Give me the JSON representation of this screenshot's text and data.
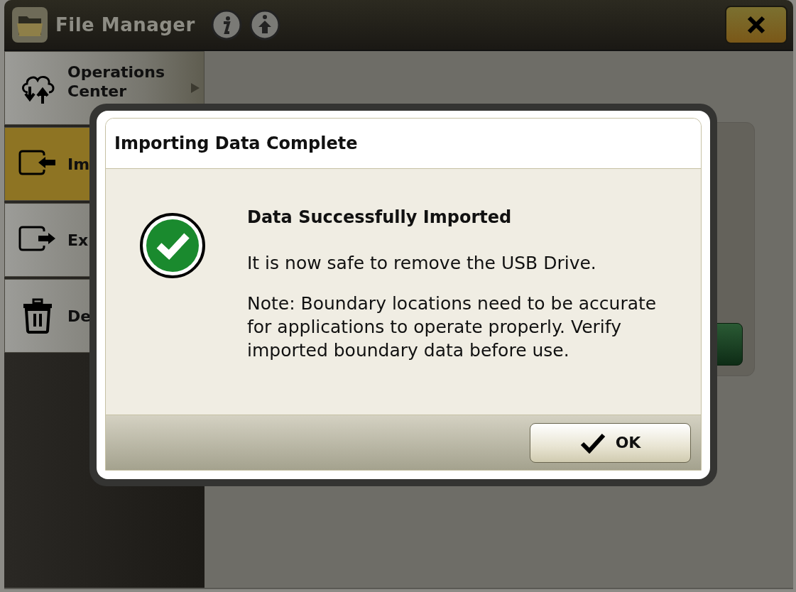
{
  "window": {
    "title": "File Manager"
  },
  "sidebar": {
    "items": [
      {
        "label": "Operations Center",
        "kind": "cloud",
        "selected": false,
        "submenu": true
      },
      {
        "label": "Im",
        "kind": "import",
        "selected": true
      },
      {
        "label": "Ex",
        "kind": "export",
        "selected": false
      },
      {
        "label": "De",
        "kind": "delete",
        "selected": false
      }
    ]
  },
  "dialog": {
    "title": "Importing Data Complete",
    "heading": "Data Successfully Imported",
    "message": "It is now safe to remove the USB Drive.",
    "note": "Note: Boundary locations need to be accurate for applications to operate properly. Verify imported boundary data before use.",
    "ok_label": "OK"
  }
}
